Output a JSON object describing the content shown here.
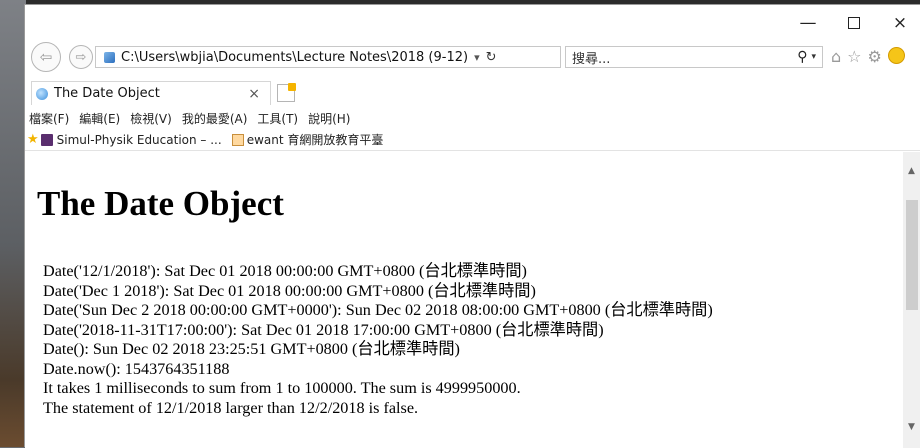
{
  "window": {
    "minimize_glyph": "—",
    "close_glyph": "×"
  },
  "nav": {
    "back_glyph": "⇦",
    "forward_glyph": "⇨",
    "address": "C:\\Users\\wbjia\\Documents\\Lecture Notes\\2018 (9-12)",
    "address_dropdown": "▾",
    "refresh_glyph": "↻",
    "search_placeholder": "搜尋...",
    "search_icon_glyph": "⚲",
    "search_dropdown": "▾",
    "home_glyph": "⌂",
    "favorites_glyph": "☆",
    "settings_glyph": "⚙"
  },
  "tab": {
    "title": "The Date Object",
    "close_glyph": "×"
  },
  "menu": {
    "items": [
      "檔案(F)",
      "編輯(E)",
      "檢視(V)",
      "我的最愛(A)",
      "工具(T)",
      "說明(H)"
    ]
  },
  "favorites": {
    "items": [
      "Simul-Physik Education – ...",
      "ewant 育網開放教育平臺"
    ]
  },
  "page": {
    "heading": "The Date Object",
    "lines": [
      "Date('12/1/2018'): Sat Dec 01 2018 00:00:00 GMT+0800 (台北標準時間)",
      "Date('Dec 1 2018'): Sat Dec 01 2018 00:00:00 GMT+0800 (台北標準時間)",
      "Date('Sun Dec 2 2018 00:00:00 GMT+0000'): Sun Dec 02 2018 08:00:00 GMT+0800 (台北標準時間)",
      "Date('2018-11-31T17:00:00'): Sat Dec 01 2018 17:00:00 GMT+0800 (台北標準時間)",
      "Date(): Sun Dec 02 2018 23:25:51 GMT+0800 (台北標準時間)",
      "Date.now(): 1543764351188",
      "It takes 1 milliseconds to sum from 1 to 100000. The sum is 4999950000.",
      "The statement of 12/1/2018 larger than 12/2/2018 is false."
    ]
  },
  "colors": {
    "accent": "#3a8edb",
    "star": "#f2b400"
  }
}
